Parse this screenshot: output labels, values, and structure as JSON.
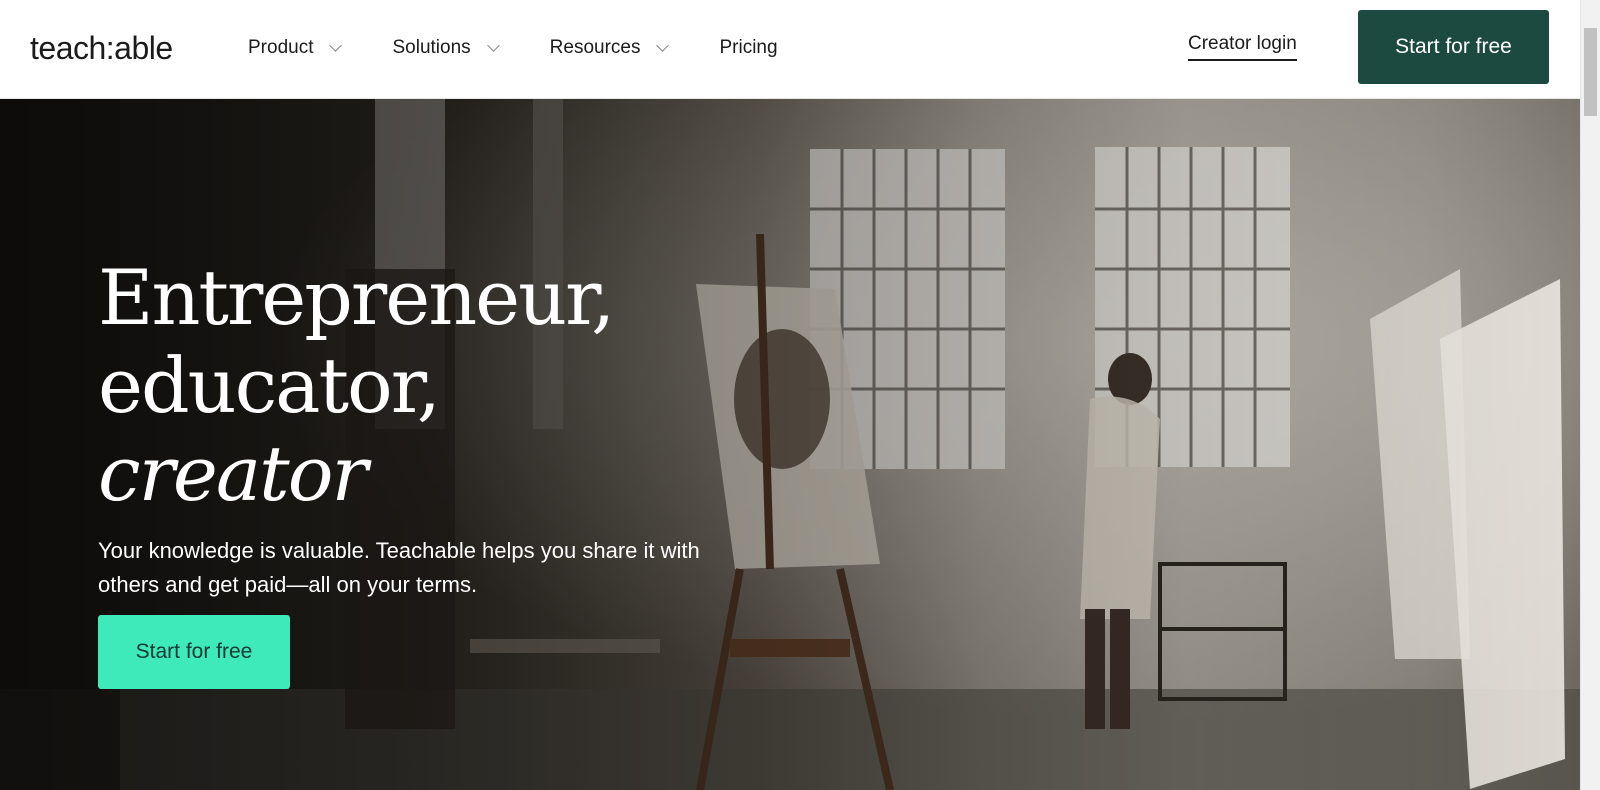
{
  "header": {
    "logo": "teach:able",
    "nav": [
      {
        "label": "Product",
        "has_dropdown": true
      },
      {
        "label": "Solutions",
        "has_dropdown": true
      },
      {
        "label": "Resources",
        "has_dropdown": true
      },
      {
        "label": "Pricing",
        "has_dropdown": false
      }
    ],
    "login_label": "Creator login",
    "cta_label": "Start for free"
  },
  "hero": {
    "title_line1": "Entrepreneur,",
    "title_line2": "educator,",
    "title_line3": "creator",
    "subtitle": "Your knowledge is valuable. Teachable helps you share it with others and get paid—all on your terms.",
    "cta_label": "Start for free"
  },
  "colors": {
    "brand_dark": "#1c4a41",
    "accent_mint": "#3eeab9",
    "text": "#1b1b1b"
  }
}
